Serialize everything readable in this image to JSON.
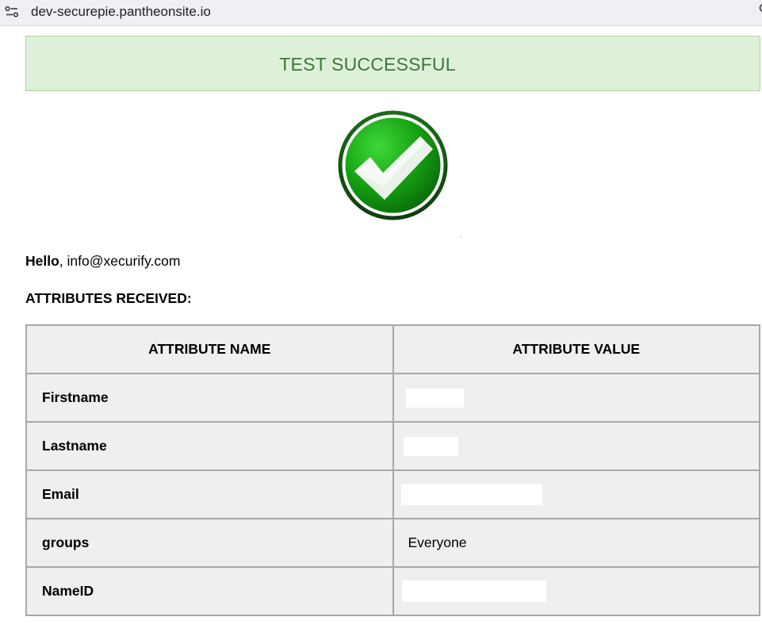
{
  "browser": {
    "url": "dev-securepie.pantheonsite.io"
  },
  "banner": {
    "text": "TEST SUCCESSFUL",
    "background": "#dff0d8",
    "text_color": "#3c763d"
  },
  "status_icon": "green-checkmark-icon",
  "greeting": {
    "label": "Hello",
    "separator": ",",
    "email": "info@xecurify.com"
  },
  "attributes_heading": "ATTRIBUTES RECEIVED:",
  "table": {
    "headers": [
      "ATTRIBUTE NAME",
      "ATTRIBUTE VALUE"
    ],
    "rows": [
      {
        "name": "Firstname",
        "value": ""
      },
      {
        "name": "Lastname",
        "value": ""
      },
      {
        "name": "Email",
        "value": ""
      },
      {
        "name": "groups",
        "value": "Everyone"
      },
      {
        "name": "NameID",
        "value": ""
      }
    ]
  }
}
